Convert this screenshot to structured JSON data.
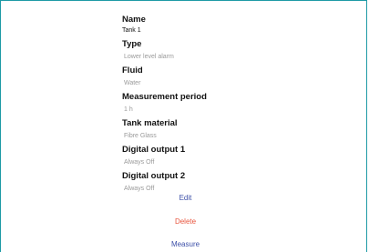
{
  "fields": [
    {
      "label": "Name",
      "value": "Tank 1"
    },
    {
      "label": "Type",
      "value": "Lower level alarm"
    },
    {
      "label": "Fluid",
      "value": "Water"
    },
    {
      "label": "Measurement period",
      "value": "1 h"
    },
    {
      "label": "Tank material",
      "value": "Fibre Glass"
    },
    {
      "label": "Digital output 1",
      "value": "Always Off"
    },
    {
      "label": "Digital output 2",
      "value": "Always Off"
    }
  ],
  "actions": {
    "edit": "Edit",
    "delete": "Delete",
    "measure": "Measure"
  },
  "colors": {
    "accent": "#3c4fa8",
    "danger": "#e8553e",
    "frame": "#1e9aa6",
    "muted": "#9a9a9a"
  }
}
